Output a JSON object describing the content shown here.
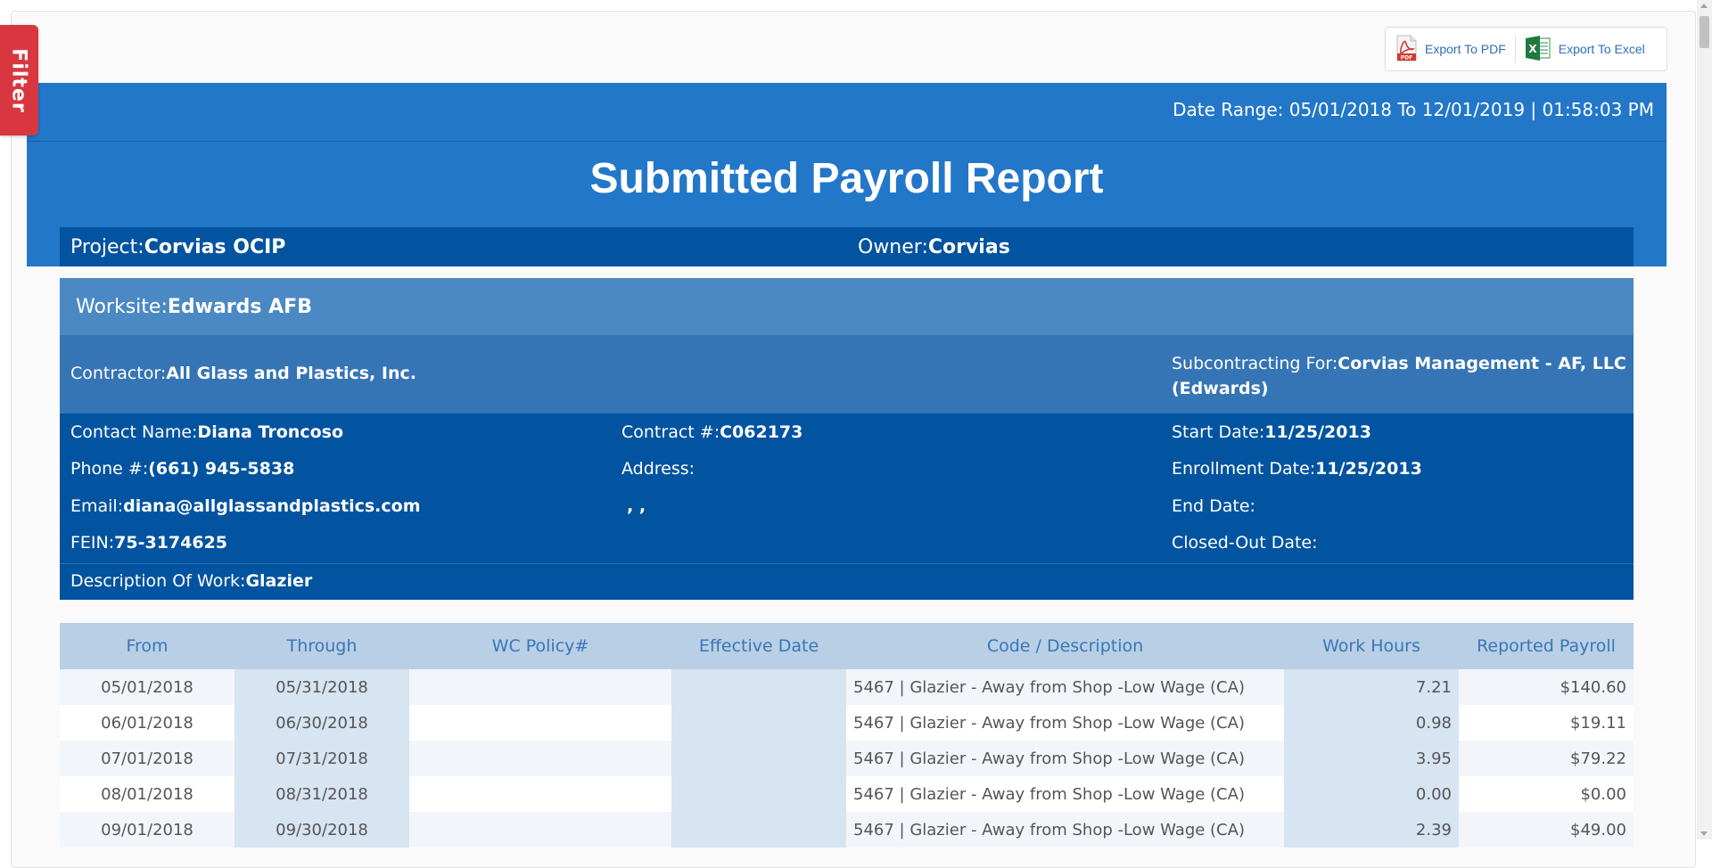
{
  "filter": {
    "label": "Filter"
  },
  "export": {
    "pdf_label": "Export To PDF",
    "excel_label": "Export To Excel"
  },
  "header": {
    "date_range": "Date Range: 05/01/2018 To 12/01/2019 | 01:58:03 PM",
    "title": "Submitted Payroll Report",
    "project_label": "Project:",
    "project_value": "Corvias OCIP",
    "owner_label": "Owner:",
    "owner_value": "Corvias"
  },
  "worksite": {
    "label": "Worksite:",
    "value": "Edwards AFB"
  },
  "contractor": {
    "label": "Contractor:",
    "value": "All Glass and Plastics, Inc.",
    "subcontracting_label": "Subcontracting For:",
    "subcontracting_value": "Corvias Management - AF, LLC (Edwards)"
  },
  "details": {
    "contact_label": "Contact Name:",
    "contact_value": "Diana Troncoso",
    "phone_label": "Phone #:",
    "phone_value": "(661) 945-5838",
    "email_label": "Email:",
    "email_value": "diana@allglassandplastics.com",
    "fein_label": "FEIN:",
    "fein_value": "75-3174625",
    "contract_label": "Contract #:",
    "contract_value": "C062173",
    "address_label": "Address:",
    "address_value": ", ,",
    "start_label": "Start Date:",
    "start_value": "11/25/2013",
    "enroll_label": "Enrollment Date:",
    "enroll_value": "11/25/2013",
    "end_label": "End Date:",
    "closed_label": "Closed-Out Date:",
    "desc_label": "Description Of Work:",
    "desc_value": "Glazier"
  },
  "table": {
    "headers": [
      "From",
      "Through",
      "WC Policy#",
      "Effective Date",
      "Code / Description",
      "Work Hours",
      "Reported Payroll"
    ],
    "rows": [
      [
        "05/01/2018",
        "05/31/2018",
        "",
        "",
        "5467 | Glazier - Away from Shop -Low Wage (CA)",
        "7.21",
        "$140.60"
      ],
      [
        "06/01/2018",
        "06/30/2018",
        "",
        "",
        "5467 | Glazier - Away from Shop -Low Wage (CA)",
        "0.98",
        "$19.11"
      ],
      [
        "07/01/2018",
        "07/31/2018",
        "",
        "",
        "5467 | Glazier - Away from Shop -Low Wage (CA)",
        "3.95",
        "$79.22"
      ],
      [
        "08/01/2018",
        "08/31/2018",
        "",
        "",
        "5467 | Glazier - Away from Shop -Low Wage (CA)",
        "0.00",
        "$0.00"
      ],
      [
        "09/01/2018",
        "09/30/2018",
        "",
        "",
        "5467 | Glazier - Away from Shop -Low Wage (CA)",
        "2.39",
        "$49.00"
      ]
    ]
  },
  "colors": {
    "header_blue": "#2277c8",
    "dark_blue": "#0253a0",
    "worksite_blue": "#4a89c3",
    "filter_red": "#d9373f",
    "table_header": "#b8cfe5"
  }
}
